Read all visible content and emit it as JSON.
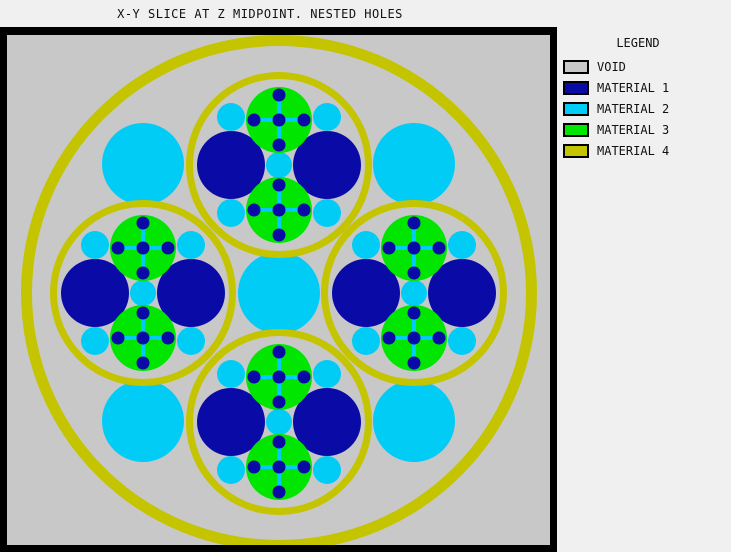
{
  "title": "X-Y SLICE AT Z MIDPOINT.  NESTED HOLES",
  "legend": {
    "title": "LEGEND",
    "items": [
      {
        "label": "VOID",
        "color": "#c8c8c8",
        "icon": "void-swatch"
      },
      {
        "label": "MATERIAL 1",
        "color": "#0a0aa6",
        "icon": "material-1-swatch"
      },
      {
        "label": "MATERIAL 2",
        "color": "#00ccf5",
        "icon": "material-2-swatch"
      },
      {
        "label": "MATERIAL 3",
        "color": "#00e600",
        "icon": "material-3-swatch"
      },
      {
        "label": "MATERIAL 4",
        "color": "#c4c400",
        "icon": "material-4-swatch"
      }
    ]
  },
  "geometry_description": {
    "outer_ring_material": "MATERIAL 4",
    "background_material": "VOID",
    "nested_units": 4,
    "corner_holes_material": "MATERIAL 2",
    "center_hole_material": "MATERIAL 2"
  }
}
